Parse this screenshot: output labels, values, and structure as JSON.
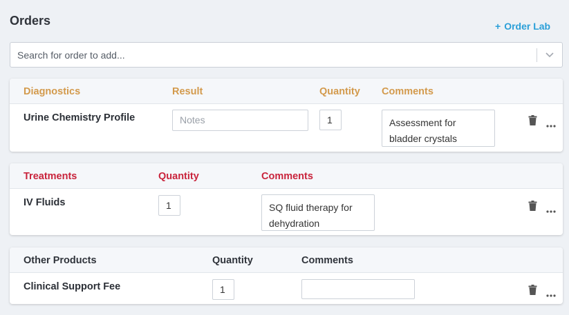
{
  "header": {
    "title": "Orders",
    "order_lab_plus": "+",
    "order_lab_label": "Order Lab"
  },
  "search": {
    "placeholder": "Search for order to add..."
  },
  "diagnostics": {
    "columns": {
      "name": "Diagnostics",
      "result": "Result",
      "quantity": "Quantity",
      "comments": "Comments"
    },
    "row": {
      "name": "Urine Chemistry Profile",
      "result_placeholder": "Notes",
      "quantity": "1",
      "comments": "Assessment for bladder crystals"
    }
  },
  "treatments": {
    "columns": {
      "name": "Treatments",
      "quantity": "Quantity",
      "comments": "Comments"
    },
    "row": {
      "name": "IV Fluids",
      "quantity": "1",
      "comments": "SQ fluid therapy for dehydration"
    }
  },
  "other_products": {
    "columns": {
      "name": "Other Products",
      "quantity": "Quantity",
      "comments": "Comments"
    },
    "row": {
      "name": "Clinical Support Fee",
      "quantity": "1",
      "comments": ""
    }
  },
  "icons": [
    "chevron-down-icon",
    "trash-icon",
    "more-icon"
  ],
  "colors": {
    "accent": "#2a9fd8",
    "diagnostics_header": "#d39a4c",
    "treatments_header": "#c9243c",
    "background": "#eef1f5"
  }
}
